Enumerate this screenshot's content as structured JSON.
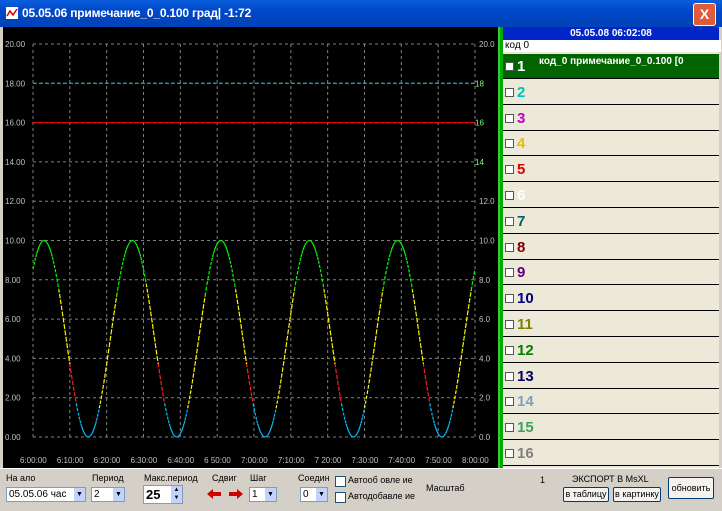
{
  "window": {
    "title": "05.05.06 примечание_0_0.100 град| -1:72",
    "close_label": "X"
  },
  "chart_data": {
    "type": "line",
    "y_left_ticks": [
      "20.00",
      "18.00",
      "16.00",
      "14.00",
      "12.00",
      "10.00",
      "8.00",
      "6.00",
      "4.00",
      "2.00",
      "0.00"
    ],
    "y_right_ticks": [
      "20.0",
      "18",
      "16",
      "14",
      "12.0",
      "10.0",
      "8.0",
      "6.0",
      "4.0",
      "2.0",
      "0.0"
    ],
    "right_ticks_green": [
      "",
      "18",
      "16",
      "14",
      "",
      "",
      "",
      "",
      "",
      "",
      ""
    ],
    "x_ticks": [
      "6:00:00",
      "6:10:00",
      "6:20:00",
      "6:30:00",
      "6:40:00",
      "6 50:00",
      "7:00:00",
      "7:10:00",
      "7 20:00",
      "7:30:00",
      "7:40:00",
      "7:50:00",
      "8:00:00"
    ],
    "ylim": [
      0,
      20
    ],
    "hlines": [
      {
        "value": 16,
        "color": "#ff0000"
      },
      {
        "value": 18,
        "color": "#00c0c0"
      }
    ],
    "series": [
      {
        "amplitude": 10,
        "period_minutes": 24,
        "offset": 0,
        "colors": {
          "rise_low": "#00c0ff",
          "rise_high": "#ffff00",
          "top": "#00ff00",
          "fall_high": "#ffff00",
          "fall_low": "#ff2020",
          "bottom": "#00c0ff"
        }
      }
    ]
  },
  "panel": {
    "header": "05.05.08 06:02:08",
    "code_label": "код 0",
    "rows": [
      {
        "num": "1",
        "color": "#ffffff",
        "checked": true,
        "label": "код_0  примечание_0_0.100  [0",
        "selected": true
      },
      {
        "num": "2",
        "color": "#00c0c0"
      },
      {
        "num": "3",
        "color": "#c000c0"
      },
      {
        "num": "4",
        "color": "#e0c000"
      },
      {
        "num": "5",
        "color": "#e00000"
      },
      {
        "num": "6",
        "color": "#ffffff"
      },
      {
        "num": "7",
        "color": "#006060"
      },
      {
        "num": "8",
        "color": "#800000"
      },
      {
        "num": "9",
        "color": "#600080"
      },
      {
        "num": "10",
        "color": "#000080"
      },
      {
        "num": "11",
        "color": "#808000"
      },
      {
        "num": "12",
        "color": "#008000"
      },
      {
        "num": "13",
        "color": "#000060"
      },
      {
        "num": "14",
        "color": "#80a0c0"
      },
      {
        "num": "15",
        "color": "#40a060"
      },
      {
        "num": "16",
        "color": "#808080"
      }
    ]
  },
  "bottom": {
    "start_label": "На ало",
    "start_value": "05.05.06 час",
    "period_label": "Период",
    "period_value": "2",
    "max_period_label": "Макс.период",
    "max_period_value": "25",
    "shift_label": "Сдвиг",
    "step_label": "Шаг",
    "step_value": "1",
    "connect_label": "Соедин",
    "connect_value": "0",
    "auto1_label": "Автооб овле ие",
    "auto2_label": "Автодобавле ие",
    "scale_label": "Масштаб",
    "number_value": "1",
    "export_label": "ЭКСПОРТ В MsXL",
    "btn_table": "в таблицу",
    "btn_picture": "в картинку",
    "btn_update": "обновить"
  }
}
